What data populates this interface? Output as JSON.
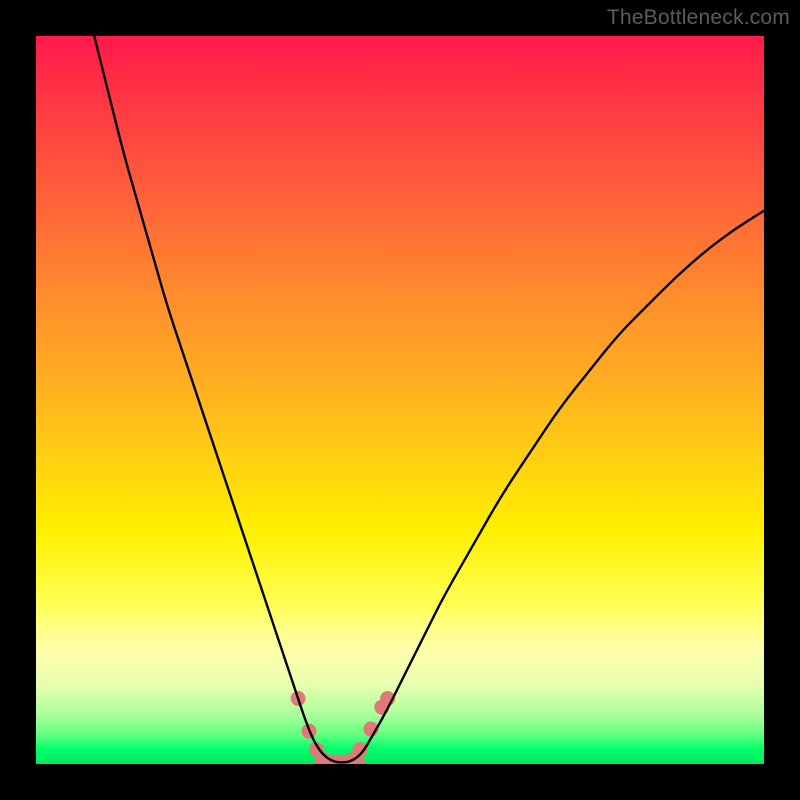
{
  "watermark": "TheBottleneck.com",
  "chart_data": {
    "type": "line",
    "title": "",
    "xlabel": "",
    "ylabel": "",
    "xlim": [
      0,
      100
    ],
    "ylim": [
      0,
      100
    ],
    "grid": false,
    "legend": false,
    "background_gradient": {
      "top": "#ff1a4a",
      "mid": "#ffff55",
      "bottom": "#00e860"
    },
    "series": [
      {
        "name": "bottleneck-curve",
        "color": "#000000",
        "x": [
          8,
          10,
          12,
          14,
          16,
          18,
          20,
          22,
          24,
          26,
          28,
          30,
          32,
          34,
          36,
          37,
          38,
          39,
          40,
          41,
          42,
          43,
          44,
          45,
          46,
          48,
          50,
          52,
          54,
          56,
          60,
          64,
          68,
          72,
          76,
          80,
          84,
          88,
          92,
          96,
          100
        ],
        "y": [
          100,
          92,
          84,
          77,
          70,
          63,
          57,
          51,
          45,
          39,
          33,
          27,
          21,
          15,
          9,
          6,
          3.5,
          1.8,
          0.8,
          0.3,
          0.2,
          0.3,
          0.8,
          1.8,
          3.5,
          7,
          11,
          15,
          19,
          23,
          30,
          37,
          43,
          49,
          54,
          59,
          63,
          67,
          70.5,
          73.5,
          76
        ]
      }
    ],
    "markers": {
      "color": "#e07a7a",
      "points": [
        {
          "x": 36.0,
          "y": 9.0
        },
        {
          "x": 37.5,
          "y": 4.5
        },
        {
          "x": 38.5,
          "y": 2.0
        },
        {
          "x": 39.5,
          "y": 0.6
        },
        {
          "x": 40.5,
          "y": 0.2
        },
        {
          "x": 41.5,
          "y": 0.2
        },
        {
          "x": 42.5,
          "y": 0.2
        },
        {
          "x": 43.5,
          "y": 0.6
        },
        {
          "x": 44.5,
          "y": 2.0
        },
        {
          "x": 46.0,
          "y": 4.8
        },
        {
          "x": 47.5,
          "y": 7.8
        },
        {
          "x": 48.3,
          "y": 9.0
        }
      ],
      "flat_segment": {
        "x0": 39.2,
        "x1": 44.2,
        "y": 0.3
      }
    }
  }
}
